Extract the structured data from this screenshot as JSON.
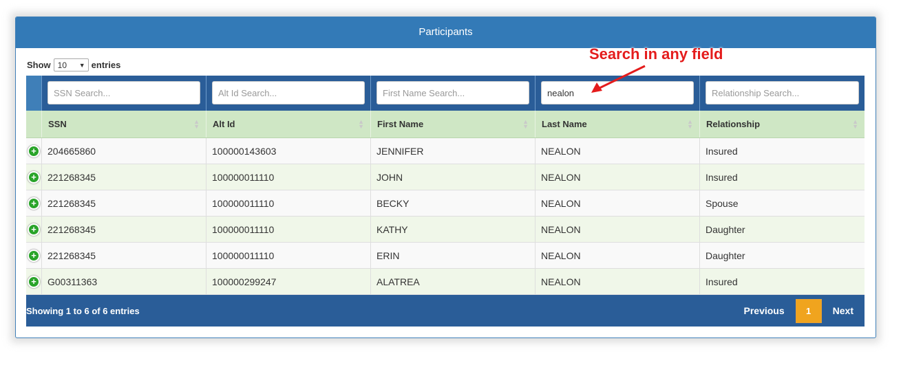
{
  "panel": {
    "title": "Participants"
  },
  "length_menu": {
    "show_label": "Show",
    "value": "10",
    "entries_label": "entries"
  },
  "search": {
    "ssn": {
      "placeholder": "SSN Search...",
      "value": ""
    },
    "alt_id": {
      "placeholder": "Alt Id Search...",
      "value": ""
    },
    "first_name": {
      "placeholder": "First Name Search...",
      "value": ""
    },
    "last_name": {
      "placeholder": "Last Name Search...",
      "value": "nealon"
    },
    "relationship": {
      "placeholder": "Relationship Search...",
      "value": ""
    }
  },
  "columns": [
    "SSN",
    "Alt Id",
    "First Name",
    "Last Name",
    "Relationship"
  ],
  "rows": [
    [
      "204665860",
      "100000143603",
      "JENNIFER",
      "NEALON",
      "Insured"
    ],
    [
      "221268345",
      "100000011110",
      "JOHN",
      "NEALON",
      "Insured"
    ],
    [
      "221268345",
      "100000011110",
      "BECKY",
      "NEALON",
      "Spouse"
    ],
    [
      "221268345",
      "100000011110",
      "KATHY",
      "NEALON",
      "Daughter"
    ],
    [
      "221268345",
      "100000011110",
      "ERIN",
      "NEALON",
      "Daughter"
    ],
    [
      "G00311363",
      "100000299247",
      "ALATREA",
      "NEALON",
      "Insured"
    ]
  ],
  "footer": {
    "info": "Showing 1 to 6 of 6 entries",
    "previous": "Previous",
    "page": "1",
    "next": "Next"
  },
  "annotation": {
    "text": "Search in any field"
  },
  "colors": {
    "header_blue": "#337ab7",
    "table_blue": "#2a5d98",
    "header_green": "#cfe7c5",
    "accent_orange": "#f0a41e",
    "annotation_red": "#e41c1c",
    "expand_green": "#2aa42a"
  },
  "icons": {
    "expand": "plus-circle-icon",
    "sort": "sort-icon",
    "dropdown": "caret-down-icon"
  }
}
